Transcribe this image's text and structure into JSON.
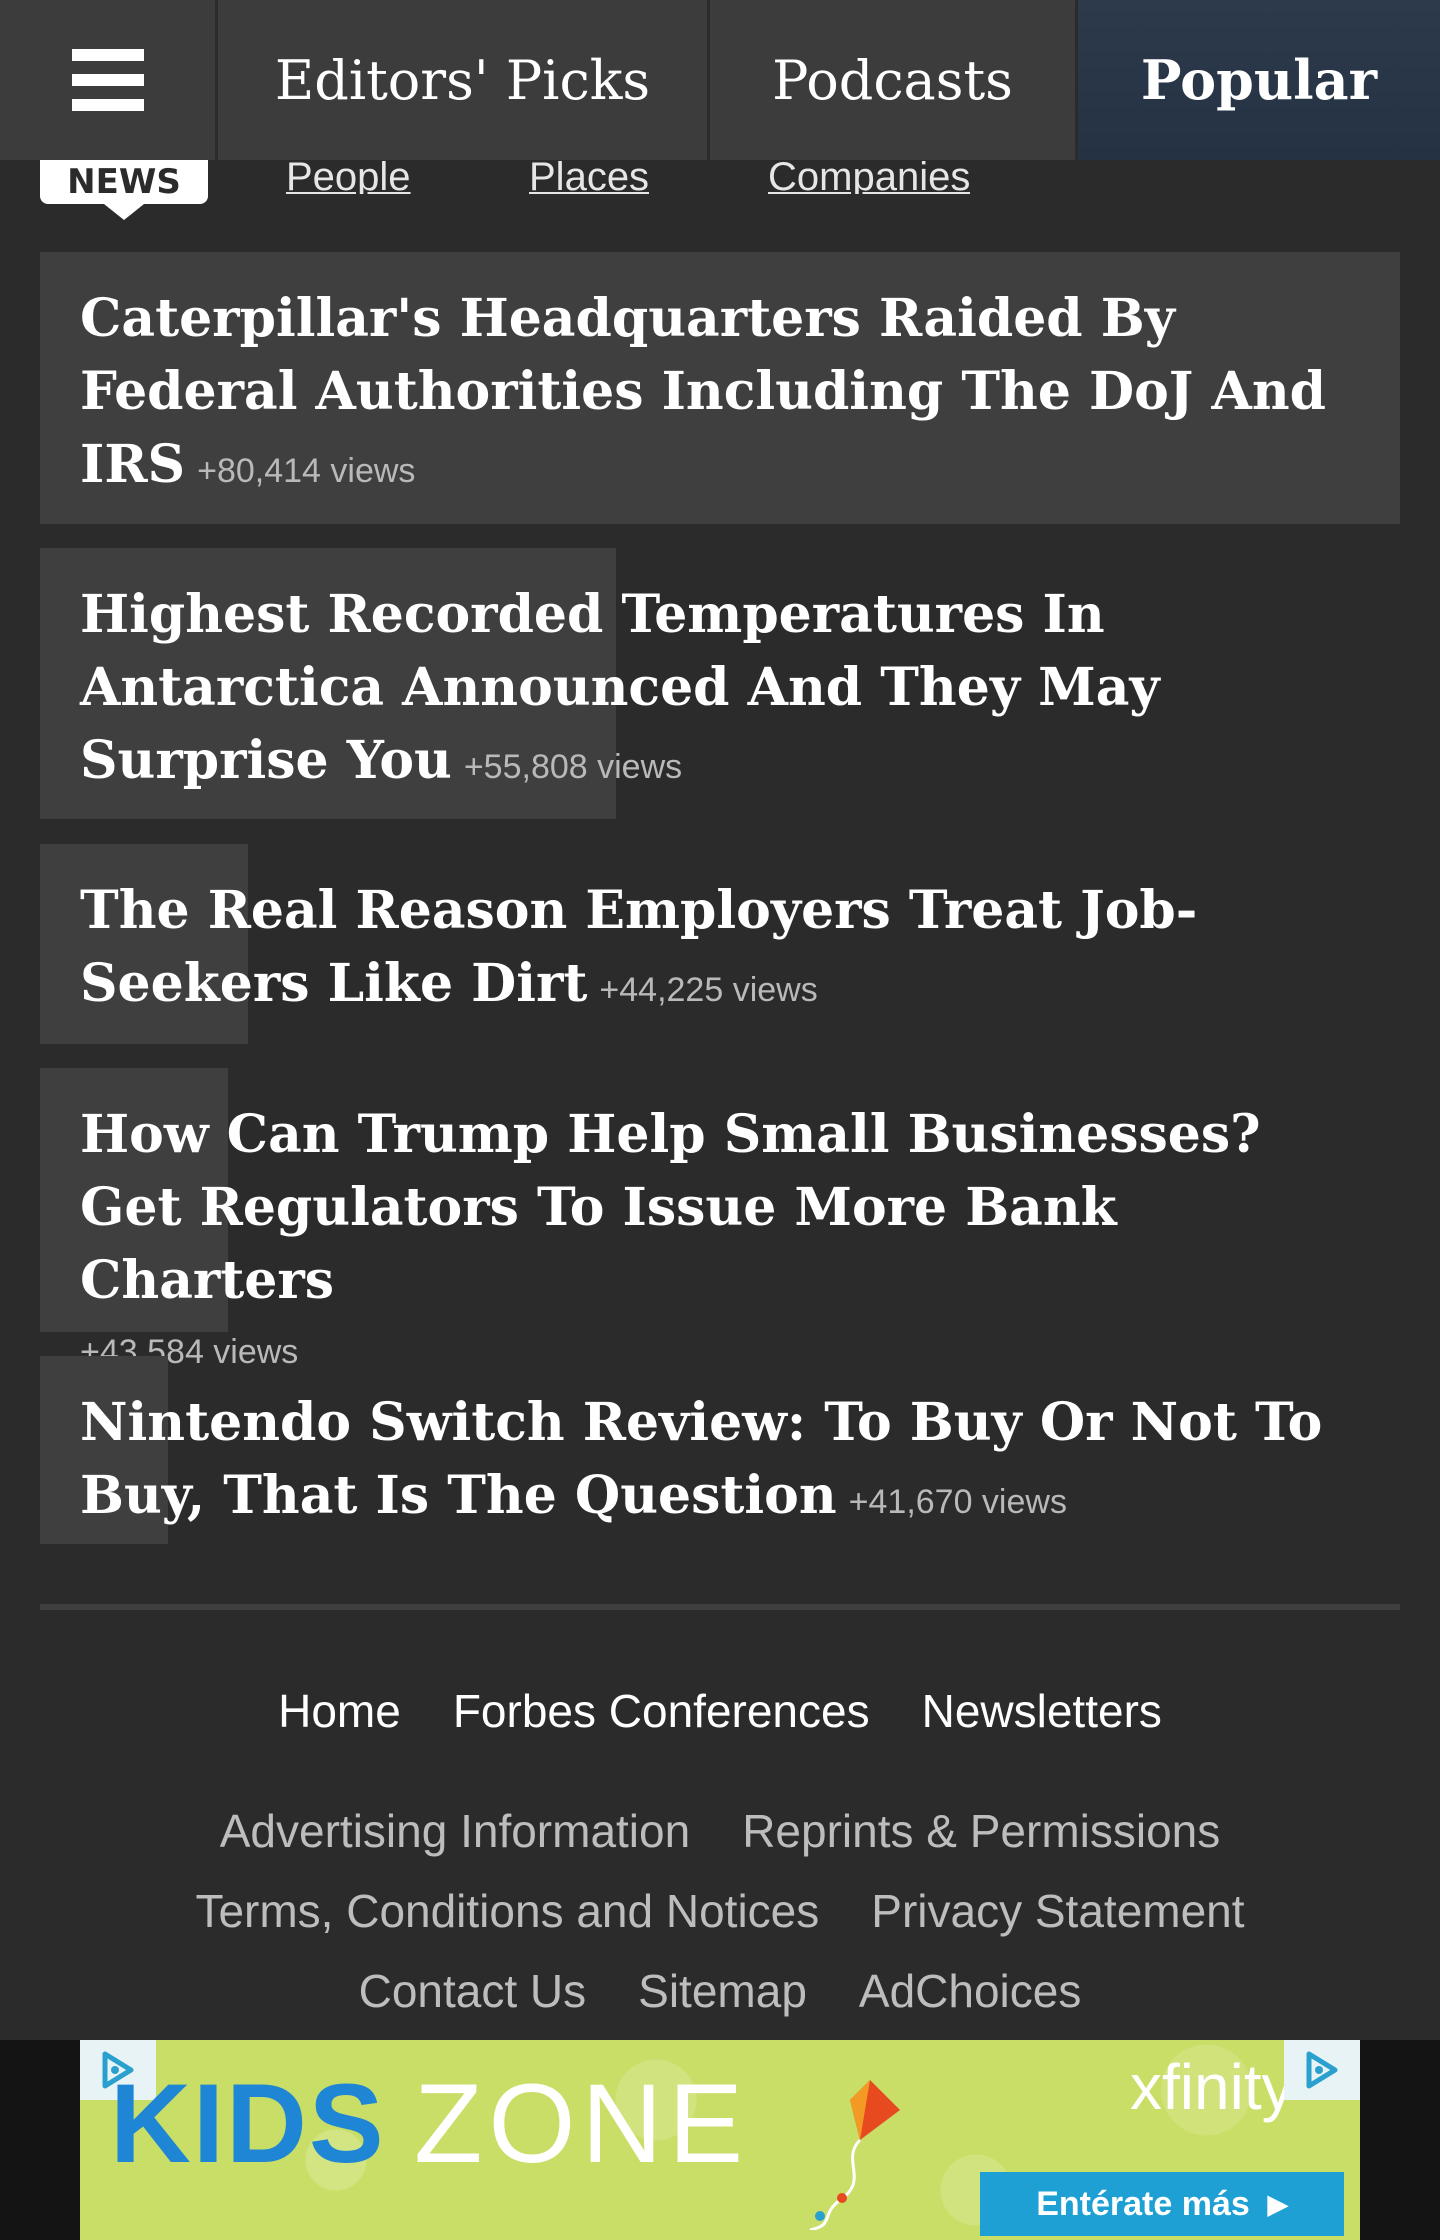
{
  "topnav": {
    "menu_icon": "hamburger-menu-icon",
    "tabs": [
      {
        "label": "Editors' Picks"
      },
      {
        "label": "Podcasts"
      },
      {
        "label": "Popular",
        "active": true
      }
    ]
  },
  "subnav": {
    "active": "NEWS",
    "links": [
      "People",
      "Places",
      "Companies"
    ]
  },
  "articles": [
    {
      "title": "Caterpillar's Headquarters Raided By Federal Authorities Including The DoJ And IRS",
      "views": "+80,414 views"
    },
    {
      "title": "Highest Recorded Temperatures In Antarctica Announced And They May Surprise You",
      "views": "+55,808 views"
    },
    {
      "title": "The Real Reason Employers Treat Job-Seekers Like Dirt",
      "views": "+44,225 views"
    },
    {
      "title": "How Can Trump Help Small Businesses? Get Regulators To Issue More Bank Charters",
      "views": "+43,584 views"
    },
    {
      "title": "Nintendo Switch Review: To Buy Or Not To Buy, That Is The Question",
      "views": "+41,670 views"
    }
  ],
  "footer": {
    "main_links": [
      "Home",
      "Forbes Conferences",
      "Newsletters"
    ],
    "row2": [
      "Advertising Information",
      "Reprints & Permissions"
    ],
    "row3": [
      "Terms, Conditions and Notices",
      "Privacy Statement"
    ],
    "row4": [
      "Contact Us",
      "Sitemap",
      "AdChoices"
    ]
  },
  "ad": {
    "kids": "KIDS",
    "zone": "ZONE",
    "brand": "xfinity",
    "cta": "Entérate más",
    "colors": {
      "background": "#c9de67",
      "kids": "#1f86d6",
      "cta": "#1ea0d4"
    }
  },
  "colors": {
    "page_bg": "#2b2b2b",
    "nav_bg": "#3c3c3c",
    "active_tab_bg": "#2c3a4c",
    "popularity_bar": "#3f3f3f"
  }
}
